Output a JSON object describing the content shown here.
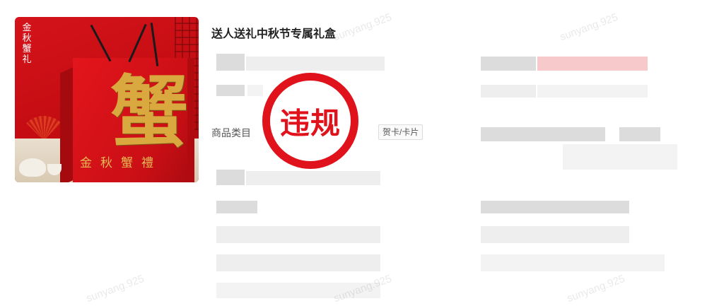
{
  "product": {
    "title": "送人送礼中秋节专属礼盒",
    "image": {
      "vertical_text": "金秋蟹礼",
      "box_big_char": "蟹",
      "box_bottom_text": "金秋蟹禮"
    }
  },
  "category": {
    "label": "商品类目",
    "tag": "贺卡/卡片"
  },
  "stamp": {
    "text": "违规",
    "color": "#e0131c"
  },
  "watermarks": [
    "sunyang.925",
    "sunyang.925",
    "sunyang.925",
    "sunyang.925",
    "sunyang.925"
  ]
}
